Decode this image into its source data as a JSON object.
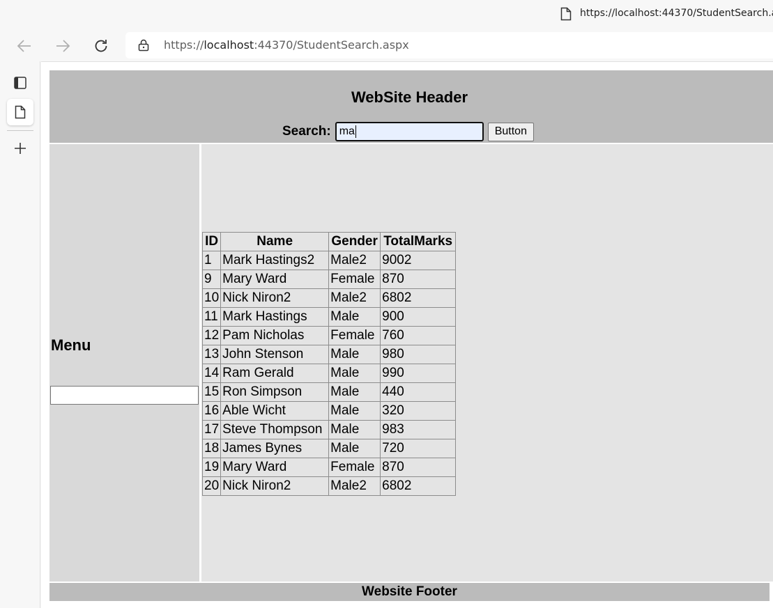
{
  "browser": {
    "tab_title": "https://localhost:44370/StudentSearch.aspx",
    "url_prefix": "https://",
    "url_host": "localhost",
    "url_rest": ":44370/StudentSearch.aspx"
  },
  "page": {
    "header_title": "WebSite Header",
    "search_label": "Search:",
    "search_value": "ma",
    "search_button": "Button",
    "menu_title": "Menu",
    "menu_input_value": "",
    "footer_title": "Website Footer"
  },
  "grid": {
    "columns": [
      "ID",
      "Name",
      "Gender",
      "TotalMarks"
    ],
    "rows": [
      [
        "1",
        "Mark Hastings2",
        "Male2",
        "9002"
      ],
      [
        "9",
        "Mary Ward",
        "Female",
        "870"
      ],
      [
        "10",
        "Nick Niron2",
        "Male2",
        "6802"
      ],
      [
        "11",
        "Mark Hastings",
        "Male",
        "900"
      ],
      [
        "12",
        "Pam Nicholas",
        "Female",
        "760"
      ],
      [
        "13",
        "John Stenson",
        "Male",
        "980"
      ],
      [
        "14",
        "Ram Gerald",
        "Male",
        "990"
      ],
      [
        "15",
        "Ron Simpson",
        "Male",
        "440"
      ],
      [
        "16",
        "Able Wicht",
        "Male",
        "320"
      ],
      [
        "17",
        "Steve Thompson",
        "Male",
        "983"
      ],
      [
        "18",
        "James Bynes",
        "Male",
        "720"
      ],
      [
        "19",
        "Mary Ward",
        "Female",
        "870"
      ],
      [
        "20",
        "Nick Niron2",
        "Male2",
        "6802"
      ]
    ]
  }
}
